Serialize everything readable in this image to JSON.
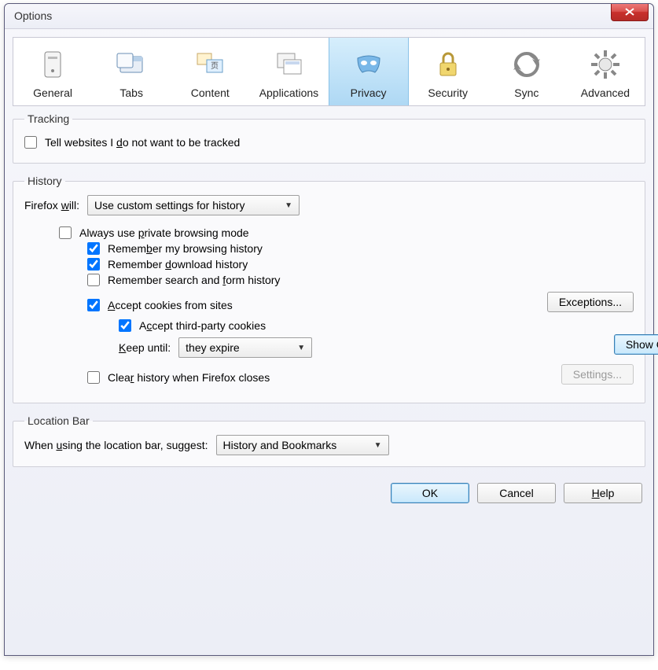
{
  "window": {
    "title": "Options"
  },
  "toolbar": {
    "items": [
      {
        "label": "General"
      },
      {
        "label": "Tabs"
      },
      {
        "label": "Content"
      },
      {
        "label": "Applications"
      },
      {
        "label": "Privacy",
        "selected": true
      },
      {
        "label": "Security"
      },
      {
        "label": "Sync"
      },
      {
        "label": "Advanced"
      }
    ]
  },
  "tracking": {
    "legend": "Tracking",
    "tell_websites": {
      "pre": "Tell websites I ",
      "u": "d",
      "post": "o not want to be tracked",
      "checked": false
    }
  },
  "history": {
    "legend": "History",
    "firefox_will_pre": "Firefox ",
    "firefox_will_u": "w",
    "firefox_will_post": "ill:",
    "firefox_will_value": "Use custom settings for history",
    "always_private": {
      "pre": "Always use ",
      "u": "p",
      "post": "rivate browsing mode",
      "checked": false
    },
    "remember_browsing": {
      "pre": "Remem",
      "u": "b",
      "post": "er my browsing history",
      "checked": true
    },
    "remember_download": {
      "pre": "Remember ",
      "u": "d",
      "post": "ownload history",
      "checked": true
    },
    "remember_search_form": {
      "pre": "Remember search and ",
      "u": "f",
      "post": "orm history",
      "checked": false
    },
    "accept_cookies": {
      "u": "A",
      "post": "ccept cookies from sites",
      "checked": true
    },
    "exceptions_label": "Exceptions...",
    "accept_third_party": {
      "pre": "A",
      "u": "c",
      "post": "cept third-party cookies",
      "checked": true
    },
    "keep_until": {
      "u": "K",
      "post": "eep until:",
      "value": "they expire"
    },
    "show_cookies_label": "Show Cookies...",
    "clear_on_close": {
      "pre": "Clea",
      "u": "r",
      "post": " history when Firefox closes",
      "checked": false
    },
    "settings_label": "Settings..."
  },
  "location_bar": {
    "legend": "Location Bar",
    "label_pre": "When ",
    "label_u": "u",
    "label_post": "sing the location bar, suggest:",
    "value": "History and Bookmarks"
  },
  "buttons": {
    "ok": "OK",
    "cancel": "Cancel",
    "help_u": "H",
    "help_post": "elp"
  }
}
